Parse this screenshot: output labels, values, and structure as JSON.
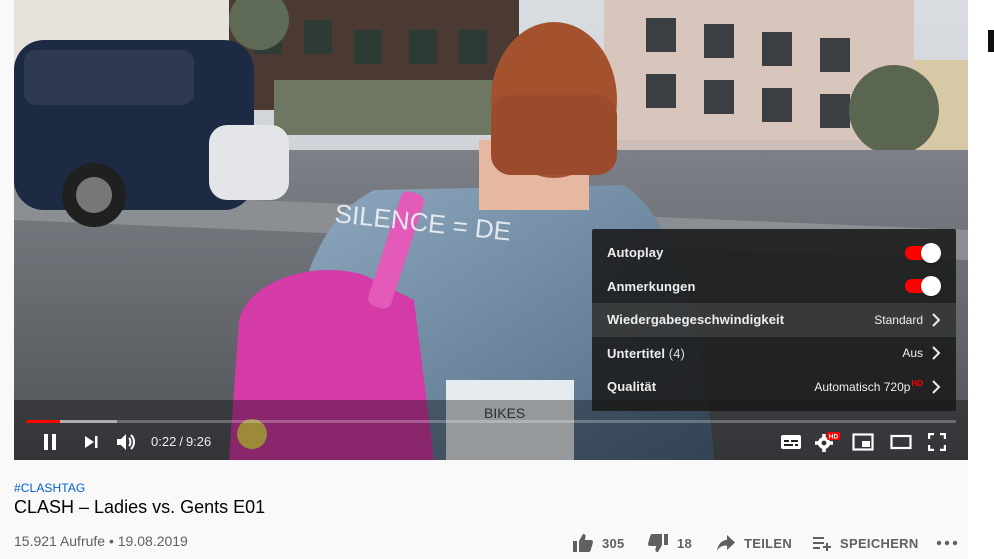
{
  "video": {
    "time": {
      "current": "0:22",
      "separator": "/",
      "duration": "9:26"
    },
    "progress": {
      "played_fraction": 0.037,
      "buffered_fraction": 0.098
    }
  },
  "settings_menu": {
    "items": [
      {
        "label": "Autoplay",
        "type": "toggle",
        "on": true
      },
      {
        "label": "Anmerkungen",
        "type": "toggle",
        "on": true
      },
      {
        "label": "Wiedergabegeschwindigkeit",
        "value": "Standard",
        "type": "submenu",
        "highlighted": true
      },
      {
        "label": "Untertitel",
        "count": "(4)",
        "value": "Aus",
        "type": "submenu"
      },
      {
        "label": "Qualität",
        "value": "Automatisch 720p",
        "badge": "HD",
        "type": "submenu"
      }
    ]
  },
  "controls": {
    "icons": [
      "pause-icon",
      "next-icon",
      "volume-icon",
      "subtitles-icon",
      "settings-icon",
      "miniplayer-icon",
      "theater-icon",
      "fullscreen-icon"
    ],
    "settings_badge": "HD"
  },
  "info": {
    "hashtag": "#CLASHTAG",
    "title": "CLASH – Ladies vs. Gents E01",
    "views": "15.921 Aufrufe",
    "dot": "•",
    "date": "19.08.2019",
    "likes": "305",
    "dislikes": "18",
    "share_label": "TEILEN",
    "save_label": "SPEICHERN"
  },
  "colors": {
    "accent": "#ff0000",
    "link": "#065fd4",
    "text": "#030303",
    "muted": "#606060"
  }
}
